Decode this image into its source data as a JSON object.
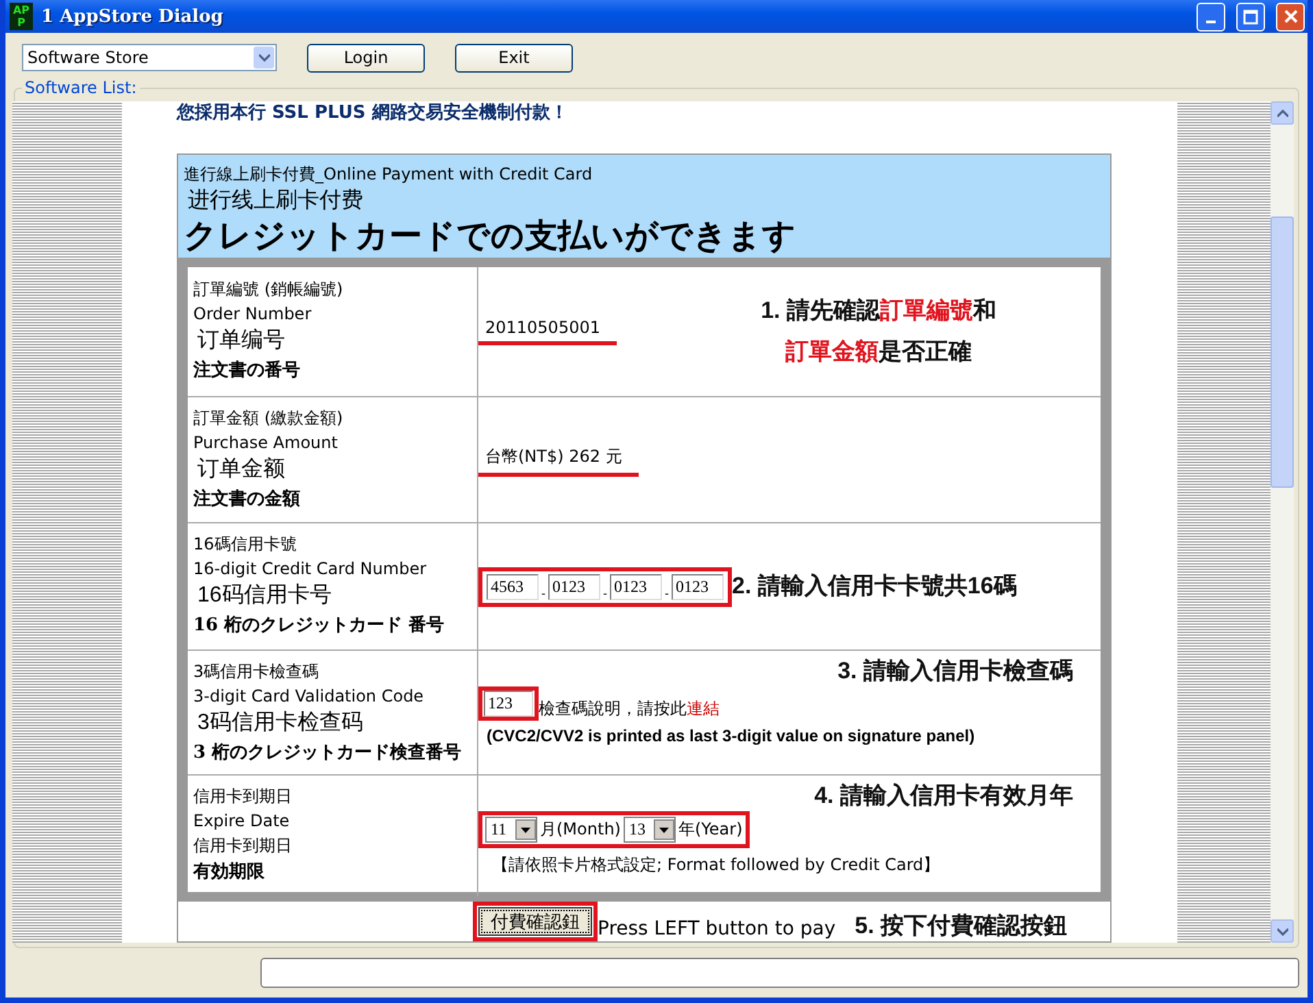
{
  "window": {
    "icon_text": "APP",
    "title": "1 AppStore Dialog"
  },
  "toolbar": {
    "store_select": "Software Store",
    "buttons": [
      "Login",
      "Exit"
    ]
  },
  "group_label": "Software List:",
  "page": {
    "notice": "您採用本行 SSL PLUS 網路交易安全機制付款！",
    "header": [
      {
        "text": "進行線上刷卡付費_Online Payment with Credit Card",
        "kind": "small"
      },
      {
        "text": "进行线上刷卡付费",
        "kind": "large"
      },
      {
        "text": "クレジットカードでの支払いができます",
        "kind": "brush"
      }
    ],
    "rows": [
      {
        "kind": "text",
        "labels": [
          {
            "text": "訂單編號 (銷帳編號)",
            "kind": "small"
          },
          {
            "text": "Order Number",
            "kind": "small"
          },
          {
            "text": "订单编号",
            "kind": "large"
          },
          {
            "text": "注文書の番号",
            "kind": "brush"
          }
        ],
        "value": "20110505001",
        "annotated": true,
        "hint": [
          [
            {
              "text": "1. 請先確認",
              "kind": "plain"
            },
            {
              "text": "訂單編號",
              "kind": "red"
            },
            {
              "text": "和",
              "kind": "plain"
            }
          ],
          [
            {
              "text": "訂單金額",
              "kind": "red"
            },
            {
              "text": "是否正確",
              "kind": "plain"
            }
          ]
        ]
      },
      {
        "kind": "text",
        "labels": [
          {
            "text": "訂單金額 (繳款金額)",
            "kind": "small"
          },
          {
            "text": "Purchase Amount",
            "kind": "small"
          },
          {
            "text": "订单金额",
            "kind": "large"
          },
          {
            "text": "注文書の金額",
            "kind": "brush"
          }
        ],
        "value": "台幣(NT$) 262 元",
        "annotated": true
      },
      {
        "kind": "card",
        "labels": [
          {
            "text": "16碼信用卡號",
            "kind": "small"
          },
          {
            "text": "16-digit Credit Card Number",
            "kind": "small"
          },
          {
            "text": "16码信用卡号",
            "kind": "large"
          },
          {
            "text": "16 桁のクレジットカード 番号",
            "kind": "brush"
          }
        ],
        "fields": [
          "4563",
          "0123",
          "0123",
          "0123"
        ],
        "separator": "-",
        "annotated": true,
        "hint": [
          [
            {
              "text": "2. 請輸入信用卡卡號共16碼",
              "kind": "plain"
            }
          ]
        ]
      },
      {
        "kind": "cvc",
        "labels": [
          {
            "text": "3碼信用卡檢查碼",
            "kind": "small"
          },
          {
            "text": "3-digit Card Validation Code",
            "kind": "small"
          },
          {
            "text": "3码信用卡检查码",
            "kind": "large"
          },
          {
            "text": "3 桁のクレジットカード検查番号",
            "kind": "brush"
          }
        ],
        "value": "123",
        "help": "檢查碼說明，請按此",
        "link": "連結",
        "note": "(CVC2/CVV2 is printed as last 3-digit value on signature panel)",
        "annotated": true,
        "hint": [
          [
            {
              "text": "3. 請輸入信用卡檢查碼",
              "kind": "plain"
            }
          ]
        ]
      },
      {
        "kind": "expiry",
        "labels": [
          {
            "text": "信用卡到期日",
            "kind": "small"
          },
          {
            "text": "Expire Date",
            "kind": "small"
          },
          {
            "text": "信用卡到期日",
            "kind": "small"
          },
          {
            "text": "有効期限",
            "kind": "brush"
          }
        ],
        "month": "11",
        "month_unit": "月(Month)",
        "year": "13",
        "year_unit": "年(Year)",
        "note": "【請依照卡片格式設定; Format followed by Credit Card】",
        "annotated": true,
        "hint": [
          [
            {
              "text": "4. 請輸入信用卡有效月年",
              "kind": "plain"
            }
          ]
        ]
      }
    ],
    "pay": {
      "button": "付費確認鈕",
      "annotated": true,
      "note": "Press LEFT button to pay",
      "hint": [
        [
          {
            "text": "5. 按下付費確認按鈕",
            "kind": "plain"
          }
        ]
      ]
    }
  }
}
